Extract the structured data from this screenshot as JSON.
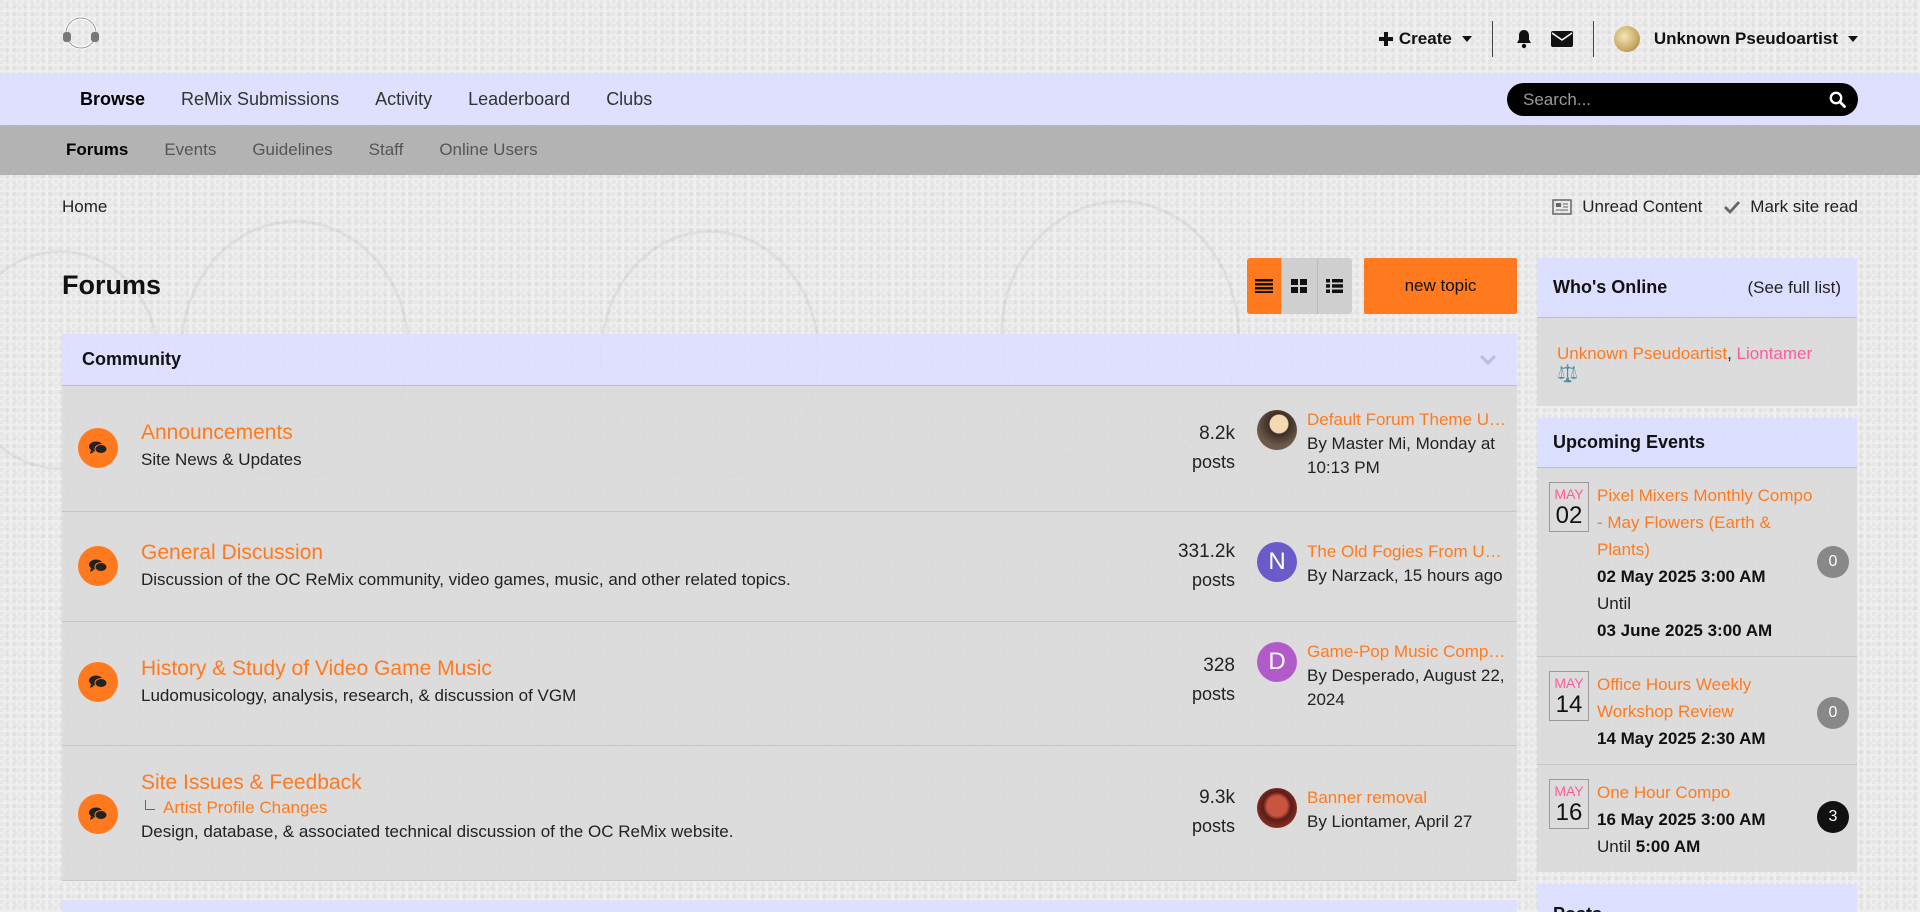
{
  "header": {
    "create_label": "Create",
    "user_name": "Unknown Pseudoartist"
  },
  "primary_nav": [
    {
      "label": "Browse",
      "active": true
    },
    {
      "label": "ReMix Submissions",
      "active": false
    },
    {
      "label": "Activity",
      "active": false
    },
    {
      "label": "Leaderboard",
      "active": false
    },
    {
      "label": "Clubs",
      "active": false
    }
  ],
  "search": {
    "placeholder": "Search..."
  },
  "secondary_nav": [
    {
      "label": "Forums",
      "active": true
    },
    {
      "label": "Events",
      "active": false
    },
    {
      "label": "Guidelines",
      "active": false
    },
    {
      "label": "Staff",
      "active": false
    },
    {
      "label": "Online Users",
      "active": false
    }
  ],
  "breadcrumb": {
    "home": "Home"
  },
  "crumb_actions": {
    "unread": "Unread Content",
    "mark_read": "Mark site read"
  },
  "page": {
    "title": "Forums",
    "new_topic": "new topic"
  },
  "category": {
    "title": "Community",
    "forums": [
      {
        "title": "Announcements",
        "description": "Site News & Updates",
        "subforum": "",
        "count": "8.2k",
        "count_label": "posts",
        "last_post_title": "Default Forum Theme Up...",
        "last_post_meta": "By Master Mi, Monday at 10:13 PM",
        "avatar_letter": "",
        "avatar_color": "#6b5a4a"
      },
      {
        "title": "General Discussion",
        "description": "Discussion of the OC ReMix community, video games, music, and other related topics.",
        "subforum": "",
        "count": "331.2k",
        "count_label": "posts",
        "last_post_title": "The Old Fogies From Un...",
        "last_post_meta": "By Narzack, 15 hours ago",
        "avatar_letter": "N",
        "avatar_color": "#6a5bc9"
      },
      {
        "title": "History & Study of Video Game Music",
        "description": "Ludomusicology, analysis, research, & discussion of VGM",
        "subforum": "",
        "count": "328",
        "count_label": "posts",
        "last_post_title": "Game-Pop Music Compar...",
        "last_post_meta": "By Desperado, August 22, 2024",
        "avatar_letter": "D",
        "avatar_color": "#b25ac9"
      },
      {
        "title": "Site Issues & Feedback",
        "description": "Design, database, & associated technical discussion of the OC ReMix website.",
        "subforum": "Artist Profile Changes",
        "count": "9.3k",
        "count_label": "posts",
        "last_post_title": "Banner removal",
        "last_post_meta": "By Liontamer, April 27",
        "avatar_letter": "",
        "avatar_color": "#8a2e24"
      }
    ]
  },
  "sidebar": {
    "whos_online": {
      "title": "Who's Online",
      "link": "(See full list)",
      "users": [
        "Unknown Pseudoartist",
        "Liontamer ⚖️"
      ]
    },
    "upcoming_events": {
      "title": "Upcoming Events",
      "events": [
        {
          "month": "MAY",
          "day": "02",
          "title": "Pixel Mixers Monthly Compo - May Flowers (Earth & Plants)",
          "start": "02 May 2025 3:00 AM",
          "until_label": "Until",
          "end": "03 June 2025 3:00 AM",
          "count": "0"
        },
        {
          "month": "MAY",
          "day": "14",
          "title": "Office Hours Weekly Workshop Review",
          "start": "14 May 2025 2:30 AM",
          "until_label": "",
          "end": "",
          "count": "0"
        },
        {
          "month": "MAY",
          "day": "16",
          "title": "One Hour Compo",
          "start": "16 May 2025 3:00 AM",
          "until_label": "Until",
          "end": "5:00 AM",
          "count": "3"
        }
      ]
    },
    "posts": {
      "title": "Posts"
    }
  }
}
